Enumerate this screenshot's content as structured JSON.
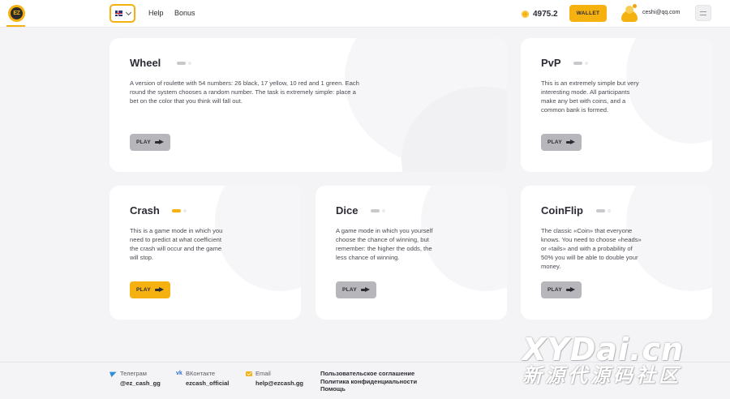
{
  "header": {
    "logo_text": "EZ",
    "nav": {
      "help": "Help",
      "bonus": "Bonus"
    },
    "balance": "4975.2",
    "wallet_label": "WALLET",
    "user_email": "ceshi@qq.com",
    "language_flag": "uk-flag-icon"
  },
  "games": [
    {
      "title": "Wheel",
      "description": "A version of roulette with 54 numbers: 26 black, 17 yellow, 10 red and 1 green. Each round the system chooses a random number. The task is extremely simple: place a bet on the color that you think will fall out.",
      "play_label": "PLAY",
      "active": false
    },
    {
      "title": "PvP",
      "description": "This is an extremely simple but very interesting mode. All participants make any bet with coins, and a common bank is formed.",
      "play_label": "PLAY",
      "active": false
    },
    {
      "title": "Crash",
      "description": "This is a game mode in which you need to predict at what coefficient the crash will occur and the game will stop.",
      "play_label": "PLAY",
      "active": true
    },
    {
      "title": "Dice",
      "description": "A game mode in which you yourself choose the chance of winning, but remember: the higher the odds, the less chance of winning.",
      "play_label": "PLAY",
      "active": false
    },
    {
      "title": "CoinFlip",
      "description": "The classic «Coin» that everyone knows. You need to choose «heads» or «tails» and with a probability of 50% you will be able to double your money.",
      "play_label": "PLAY",
      "active": false
    }
  ],
  "footer": {
    "telegram": {
      "label": "Телеграм",
      "value": "@ez_cash_gg"
    },
    "vk": {
      "label": "ВКонтакте",
      "value": "ezcash_official"
    },
    "email": {
      "label": "Email",
      "value": "help@ezcash.gg"
    },
    "links": [
      "Пользовательское соглашение",
      "Политика конфиденциальности",
      "Помощь"
    ]
  },
  "watermark": {
    "top": "XYDai.cn",
    "bottom": "新源代源码社区"
  },
  "colors": {
    "accent": "#f5b10f",
    "inactive_button": "#b7b7bb",
    "background": "#f4f4f6"
  }
}
